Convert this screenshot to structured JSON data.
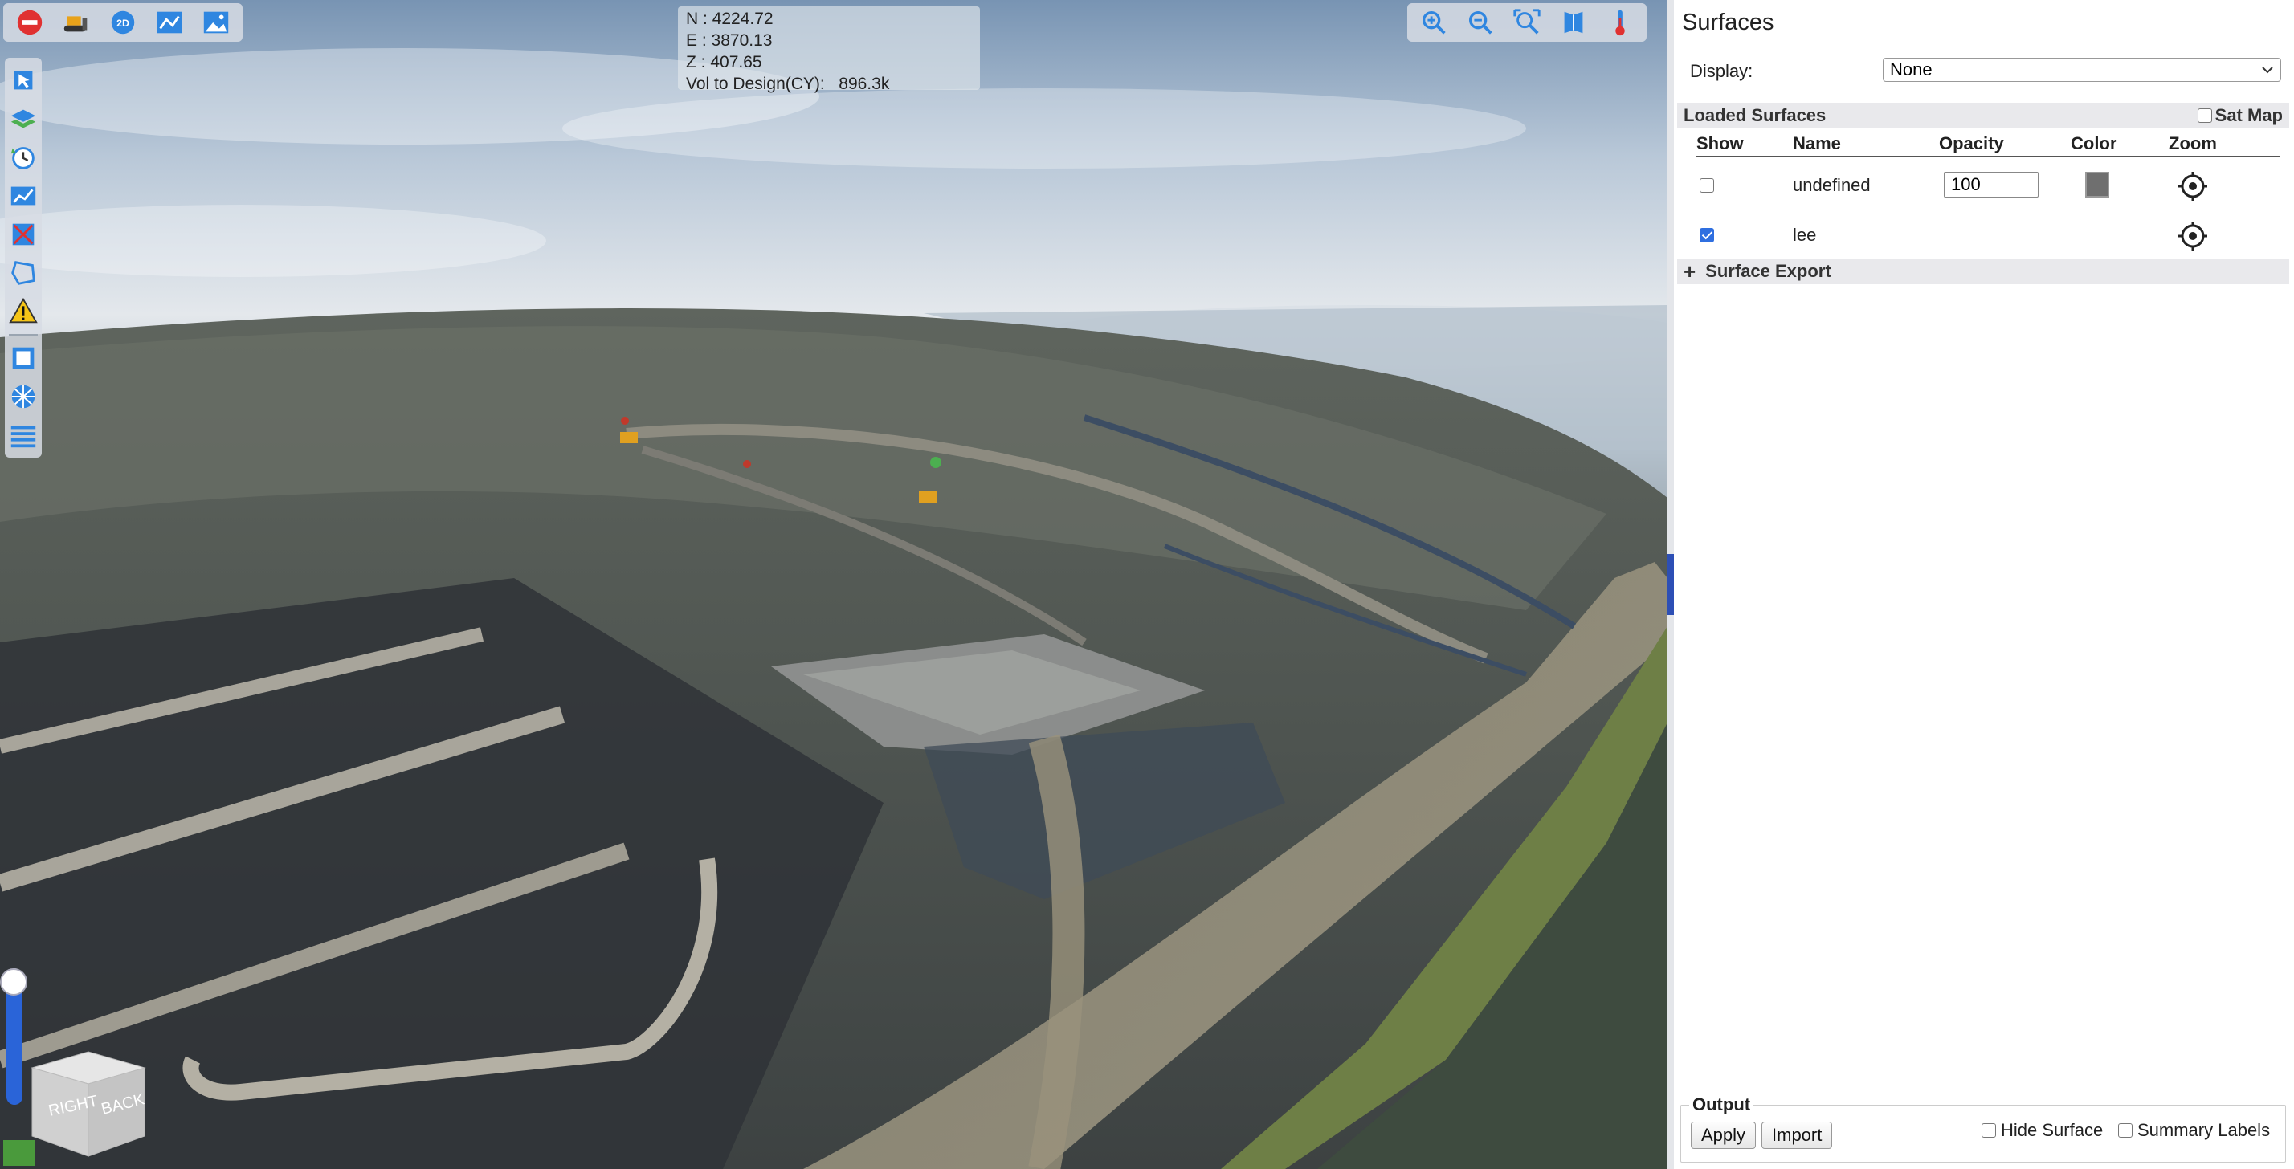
{
  "toolbar_top_left": {
    "items": [
      {
        "name": "stop-icon",
        "color": "#e03131"
      },
      {
        "name": "dozer-icon",
        "color": "#e8a21a"
      },
      {
        "name": "2d-icon",
        "label": "2D",
        "color": "#2f86e0"
      },
      {
        "name": "profile-icon",
        "color": "#2f86e0"
      },
      {
        "name": "image-icon",
        "color": "#2f86e0"
      }
    ]
  },
  "toolbar_top_right": {
    "items": [
      {
        "name": "zoom-in-icon"
      },
      {
        "name": "zoom-out-icon"
      },
      {
        "name": "zoom-extents-icon"
      },
      {
        "name": "book-icon"
      },
      {
        "name": "thermometer-icon"
      }
    ]
  },
  "toolbar_left": {
    "items": [
      {
        "name": "select-icon"
      },
      {
        "name": "layers-icon"
      },
      {
        "name": "history-icon"
      },
      {
        "name": "chart-icon"
      },
      {
        "name": "measure-icon"
      },
      {
        "name": "polygon-icon"
      },
      {
        "name": "warning-icon"
      },
      {
        "name": "square-icon"
      },
      {
        "name": "globe-icon"
      },
      {
        "name": "list-icon"
      }
    ]
  },
  "coords": {
    "n_label": "N :",
    "n_value": "4224.72",
    "e_label": "E :",
    "e_value": "3870.13",
    "z_label": "Z :",
    "z_value": "407.65",
    "vol_label": "Vol to Design(CY):",
    "vol_value": "896.3k"
  },
  "view_cube": {
    "right": "RIGHT",
    "back": "BACK"
  },
  "panel": {
    "title": "Surfaces",
    "display_label": "Display:",
    "display_value": "None",
    "loaded_title": "Loaded Surfaces",
    "satmap_label": "Sat Map",
    "satmap_checked": false,
    "columns": {
      "show": "Show",
      "name": "Name",
      "opacity": "Opacity",
      "color": "Color",
      "zoom": "Zoom"
    },
    "surfaces": [
      {
        "show": false,
        "name": "undefined",
        "opacity": "100",
        "color": "#6f6f6f"
      },
      {
        "show": true,
        "name": "lee"
      }
    ],
    "export_label": "Surface Export",
    "output": {
      "legend": "Output",
      "apply": "Apply",
      "import": "Import",
      "hide_surface": "Hide Surface",
      "summary_labels": "Summary Labels"
    }
  }
}
